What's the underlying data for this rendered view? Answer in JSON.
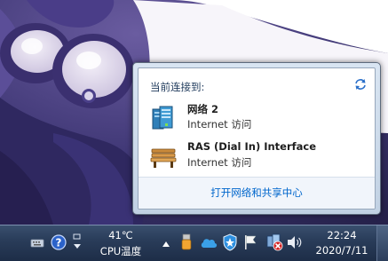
{
  "flyout": {
    "title": "当前连接到:",
    "connections": [
      {
        "name": "网络  2",
        "status": "Internet 访问",
        "icon": "network-computer-icon"
      },
      {
        "name": "RAS (Dial In) Interface",
        "status": "Internet 访问",
        "icon": "bench-icon"
      }
    ],
    "footer_link": "打开网络和共享中心"
  },
  "taskbar": {
    "cpu_temp": "41℃",
    "cpu_label": "CPU温度",
    "clock_time": "22:24",
    "clock_date": "2020/7/11"
  },
  "colors": {
    "link": "#0066cc",
    "flyout_title": "#1e395b",
    "taskbar": "#2a3d5a"
  }
}
